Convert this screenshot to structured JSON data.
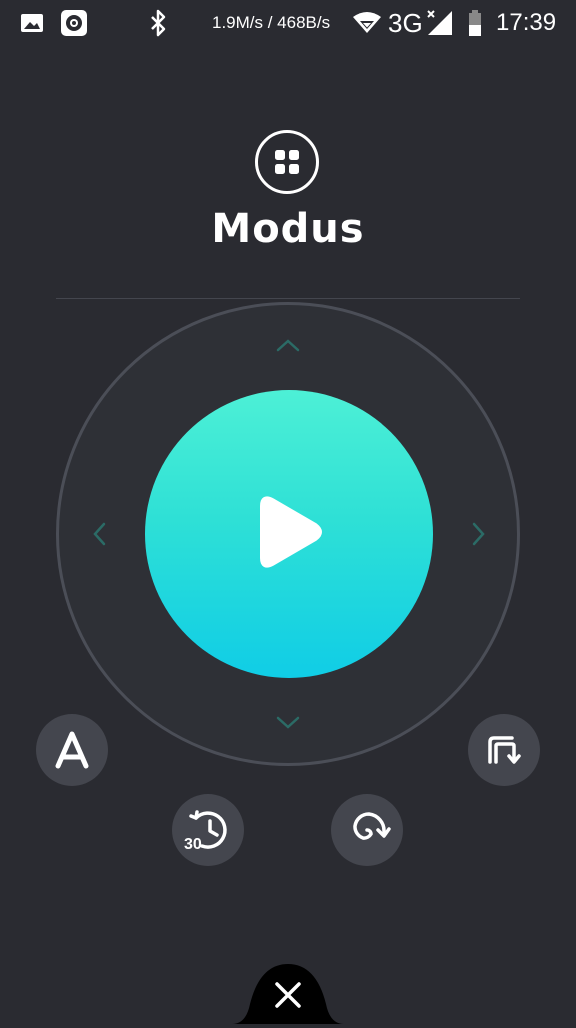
{
  "status_bar": {
    "network_speed": "1.9M/s / 468B/s",
    "network_type": "3G",
    "time": "17:39",
    "icons": [
      "image-icon",
      "music-icon",
      "bluetooth-icon",
      "wifi-icon",
      "signal-icon",
      "battery-icon"
    ]
  },
  "header": {
    "mode_icon": "grid-icon",
    "title": "Modus"
  },
  "remote": {
    "play_icon": "play-icon",
    "arrows": [
      "chevron-up-icon",
      "chevron-down-icon",
      "chevron-left-icon",
      "chevron-right-icon"
    ],
    "colors": {
      "accent_top": "#4df0d6",
      "accent_bottom": "#10cde6"
    }
  },
  "actions": {
    "auto_label": "A",
    "timer_label": "30",
    "icons": [
      "auto-mode-icon",
      "corner-mode-icon",
      "timer-30-icon",
      "spiral-mode-icon"
    ]
  },
  "footer": {
    "close_icon": "close-icon"
  }
}
